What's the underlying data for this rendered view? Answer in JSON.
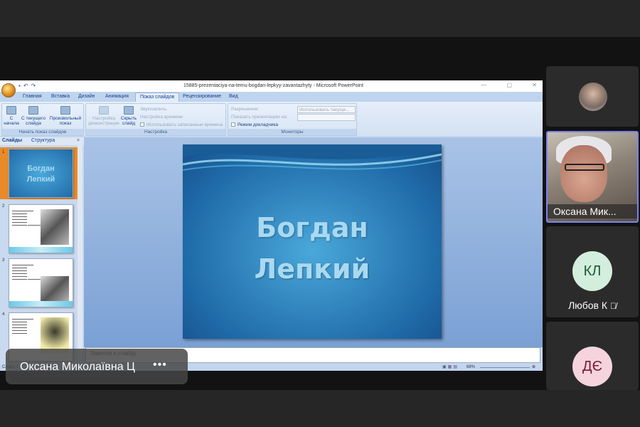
{
  "ppt": {
    "title": "15885-prezentaciya-na-temu-bogdan-lepkyy-zavantazhyty - Microsoft PowerPoint",
    "tabs": [
      "Главная",
      "Вставка",
      "Дизайн",
      "Анимация",
      "Показ слайдов",
      "Рецензирование",
      "Вид"
    ],
    "active_tab": "Показ слайдов",
    "ribbon": {
      "start_group": "Начать показ слайдов",
      "from_start": "С начала",
      "from_current": "С текущего слайда",
      "custom": "Произвольный показ",
      "setup_group": "Настройка",
      "setup_show": "Настройка демонстрации",
      "hide_slide": "Скрыть слайд",
      "record": "Звукозапись",
      "timing": "Настройка времени",
      "use_timings": "Использовать записанные времена",
      "monitors_group": "Мониторы",
      "resolution": "Разрешение:",
      "resolution_value": "Использовать текуще...",
      "show_on": "Показать презентацию на:",
      "presenter": "Режим докладчика"
    },
    "panel_tabs": [
      "Слайды",
      "Структура"
    ],
    "slide_title_line1": "Богдан",
    "slide_title_line2": "Лепкий",
    "thumb_numbers": [
      "1",
      "2",
      "3",
      "4"
    ],
    "notes_placeholder": "Заметки к слайду",
    "status_slide": "Слайд 1",
    "zoom": "68%"
  },
  "call": {
    "presenter_name": "Оксана Миколаївна Ц",
    "more": "•••",
    "video_label": "Оксана Мик...",
    "participants": [
      {
        "initials": "КЛ",
        "name": "Любов К",
        "color": "#d4eede",
        "text_color": "#1e5a32"
      },
      {
        "initials": "ДЄ",
        "color": "#f5d4de",
        "text_color": "#7a1a34"
      }
    ],
    "active_border": "#7b83eb"
  }
}
